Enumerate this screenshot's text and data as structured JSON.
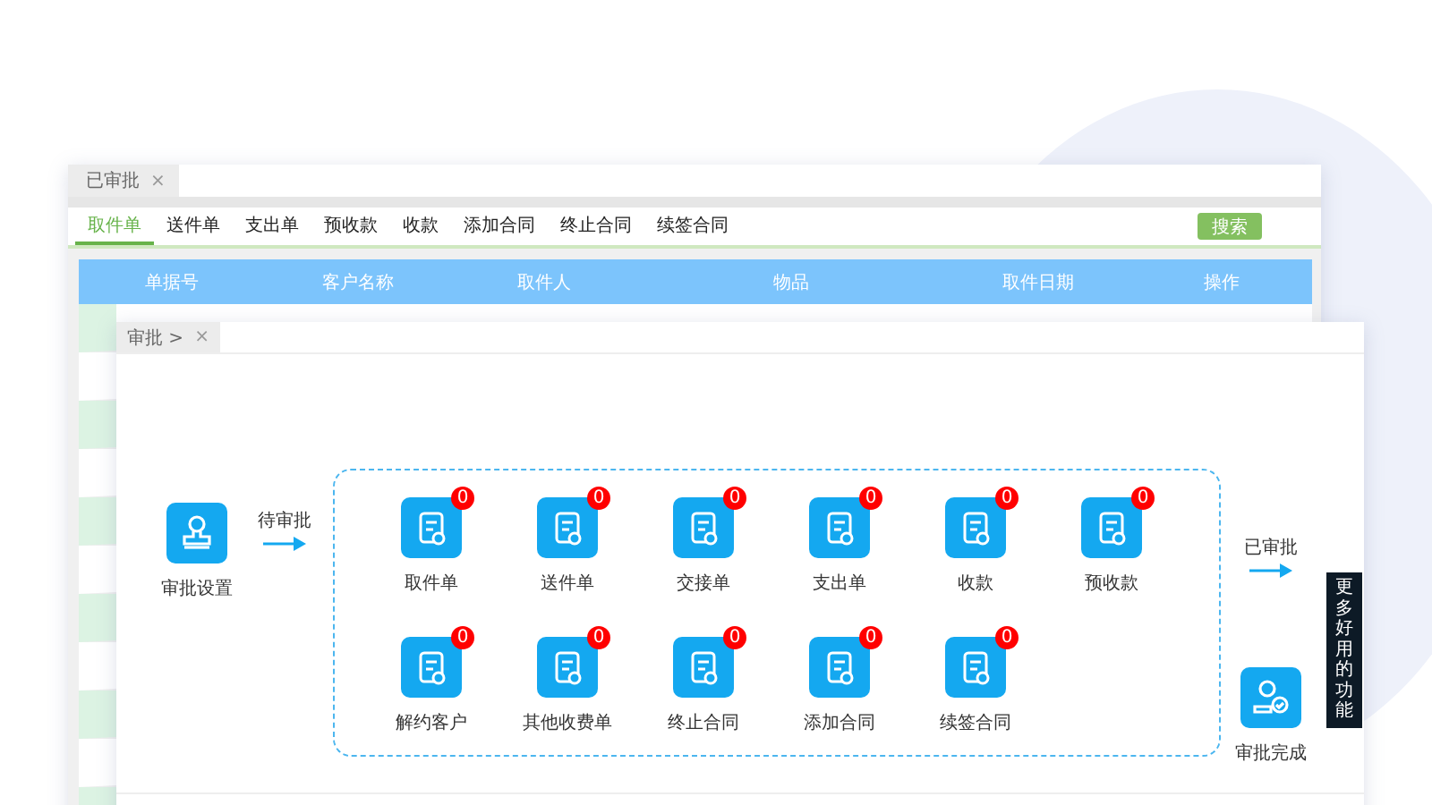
{
  "back_window": {
    "tab": {
      "label": "已审批",
      "close": "×"
    },
    "nav_tabs": [
      {
        "label": "取件单",
        "selected": true
      },
      {
        "label": "送件单",
        "selected": false
      },
      {
        "label": "支出单",
        "selected": false
      },
      {
        "label": "预收款",
        "selected": false
      },
      {
        "label": "收款",
        "selected": false
      },
      {
        "label": "添加合同",
        "selected": false
      },
      {
        "label": "终止合同",
        "selected": false
      },
      {
        "label": "续签合同",
        "selected": false
      }
    ],
    "search_button": "搜索",
    "table": {
      "columns": [
        "单据号",
        "客户名称",
        "取件人",
        "物品",
        "取件日期",
        "操作"
      ]
    }
  },
  "front_window": {
    "tab": {
      "label": "审批 >",
      "close": "×"
    },
    "start": {
      "label": "审批设置"
    },
    "pending_label": "待审批",
    "items": [
      {
        "label": "取件单",
        "badge": "0"
      },
      {
        "label": "送件单",
        "badge": "0"
      },
      {
        "label": "交接单",
        "badge": "0"
      },
      {
        "label": "支出单",
        "badge": "0"
      },
      {
        "label": "收款",
        "badge": "0"
      },
      {
        "label": "预收款",
        "badge": "0"
      },
      {
        "label": "解约客户",
        "badge": "0"
      },
      {
        "label": "其他收费单",
        "badge": "0"
      },
      {
        "label": "终止合同",
        "badge": "0"
      },
      {
        "label": "添加合同",
        "badge": "0"
      },
      {
        "label": "续签合同",
        "badge": "0"
      }
    ],
    "approved_label": "已审批",
    "end": {
      "label": "审批完成"
    }
  },
  "side_tag": "更多好用的功能"
}
